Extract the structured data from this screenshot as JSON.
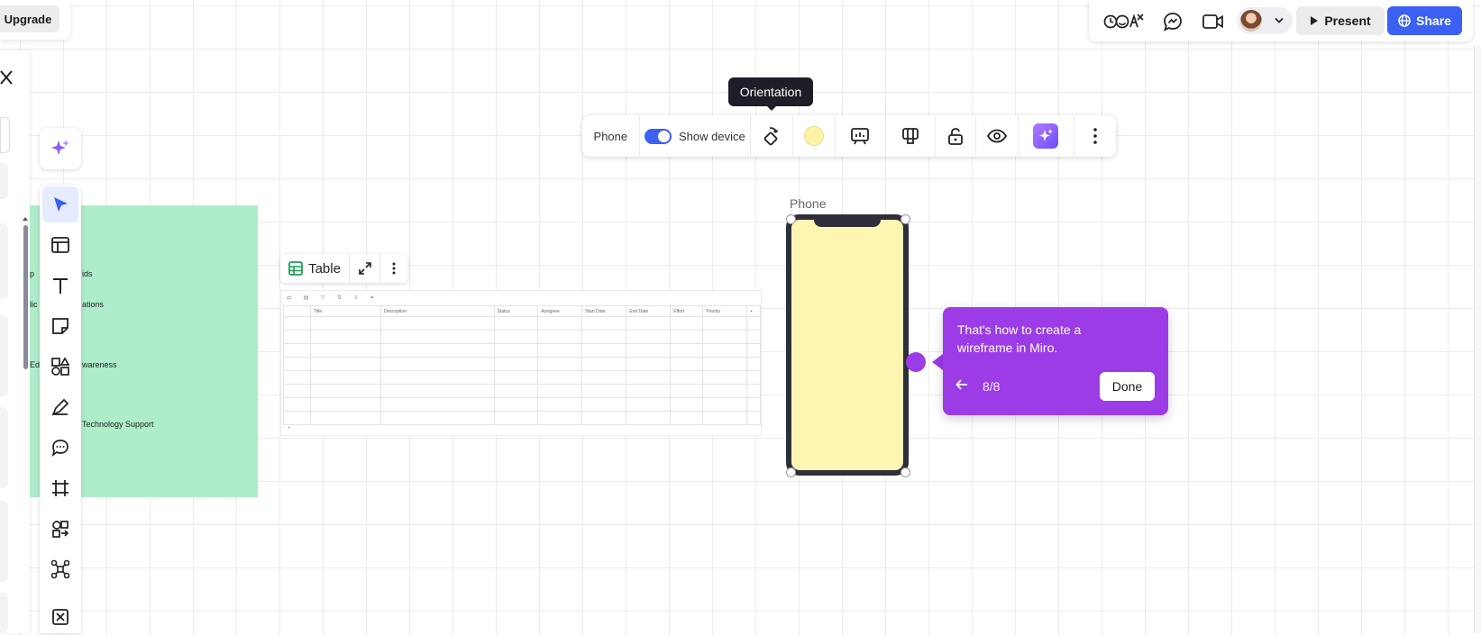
{
  "upgrade": {
    "label": "Upgrade"
  },
  "tooltip": {
    "text": "Orientation"
  },
  "context_toolbar": {
    "device_type": "Phone",
    "show_device_label": "Show device",
    "show_device_on": true,
    "fill_color": "#fdf3a8"
  },
  "table_widget": {
    "label": "Table",
    "columns": [
      "Title",
      "Description",
      "Status",
      "Assignee",
      "Start Date",
      "End Date",
      "Effort",
      "Priority",
      "+"
    ]
  },
  "green_block_texts": [
    "ids",
    "ations",
    "wareness",
    "Technology Support"
  ],
  "green_block_partial_texts": [
    "p",
    "lic",
    "Ed"
  ],
  "phone": {
    "label": "Phone",
    "screen_color": "#fef5b3"
  },
  "onboarding": {
    "message": "That's how to create a wireframe in Miro.",
    "progress": "8/8",
    "done_label": "Done",
    "accent_color": "#9b3ce6"
  },
  "header": {
    "present_label": "Present",
    "share_label": "Share",
    "accent_color": "#3c60f2"
  },
  "icons": {
    "left_toolbar": [
      "sparkle-icon",
      "select-cursor-icon",
      "templates-icon",
      "text-icon",
      "sticky-note-icon",
      "shapes-icon",
      "pen-icon",
      "comment-icon",
      "frame-icon",
      "diagram-icon",
      "mindmap-icon",
      "more-icon"
    ],
    "top_right": [
      "reactions-icon",
      "chat-icon",
      "video-icon",
      "avatar",
      "chevron-down-icon",
      "play-icon",
      "globe-icon"
    ]
  }
}
